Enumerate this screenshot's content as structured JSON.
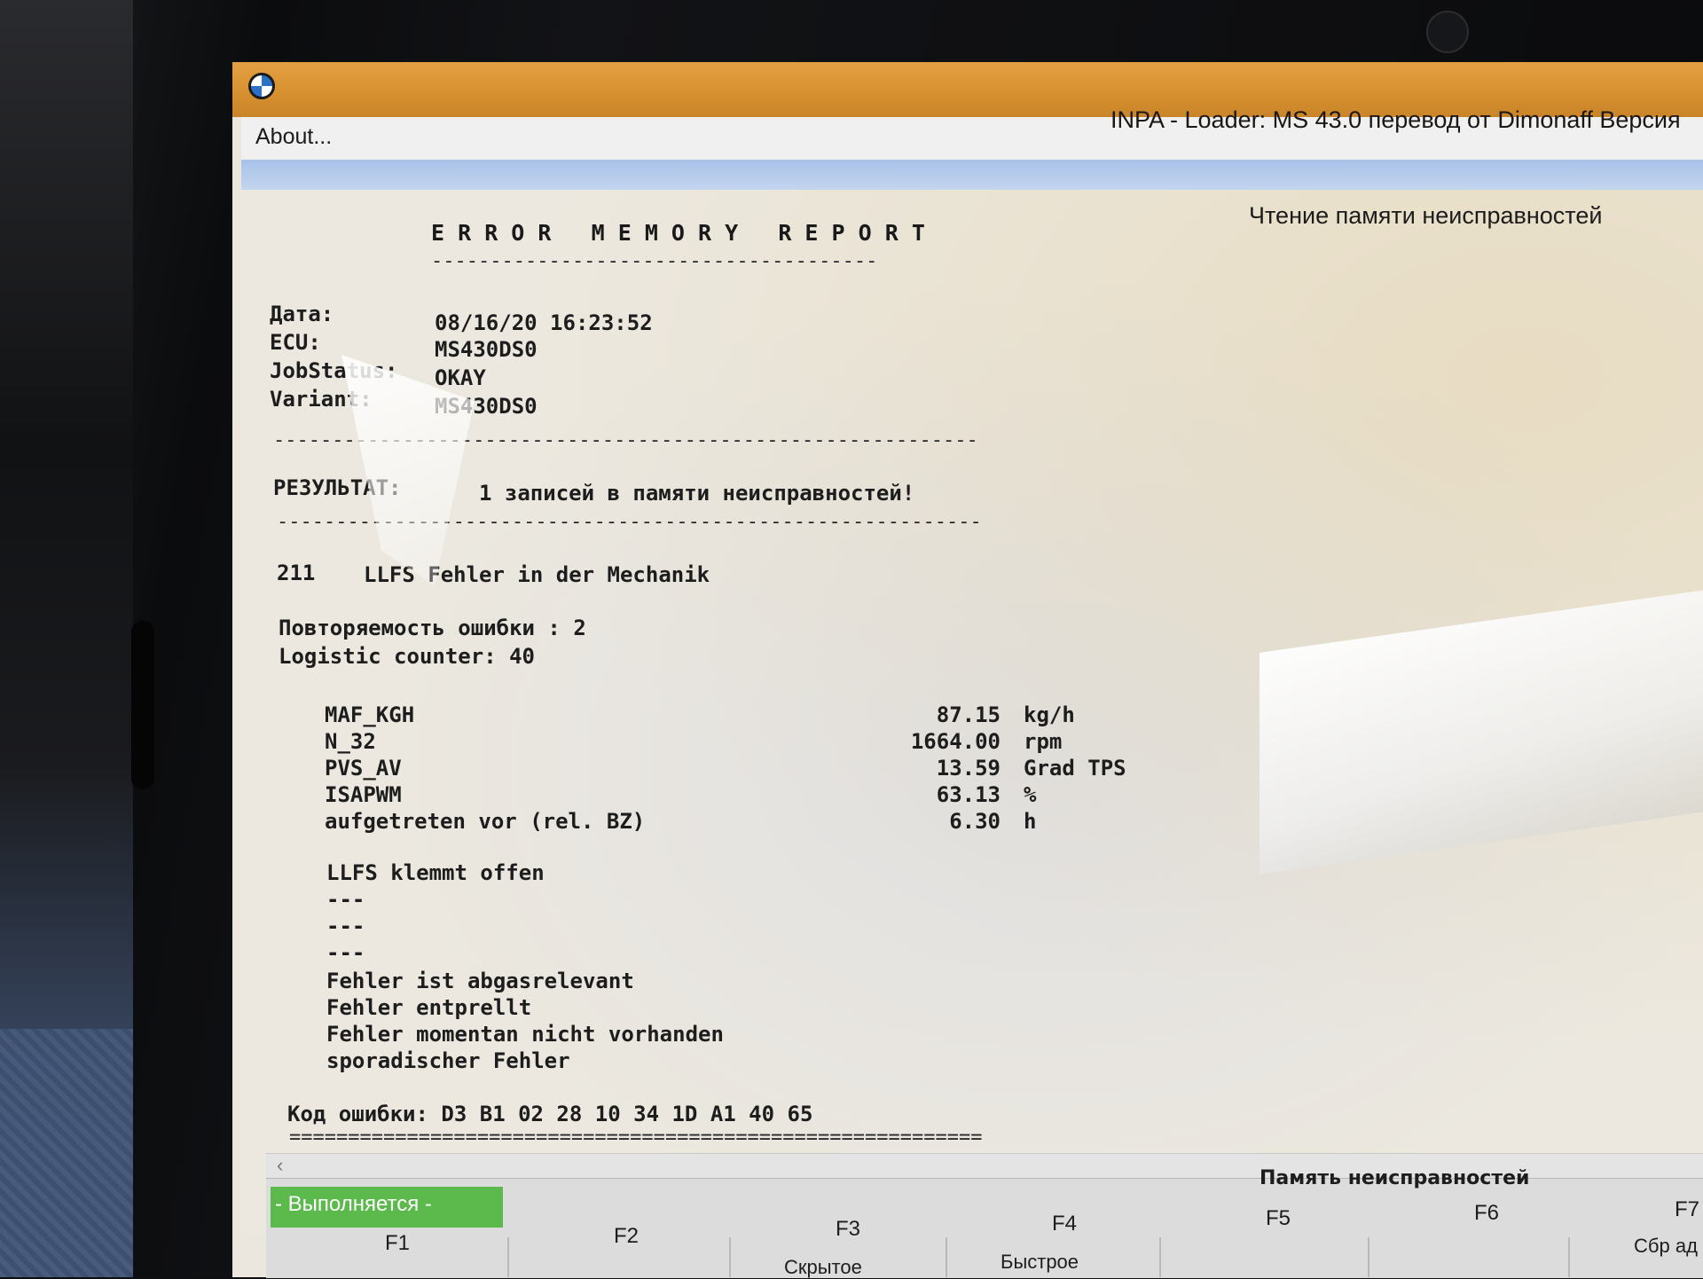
{
  "window": {
    "title": "INPA - Loader:  MS 43.0 перевод от Dimonaff Версия",
    "menu_about": "About...",
    "header_right": "Чтение памяти неисправностей"
  },
  "report": {
    "title": "E R R O R   M E M O R Y   R E P O R T",
    "title_underline": "--------------------------------------",
    "date_label": "Дата:",
    "date_value": "08/16/20 16:23:52",
    "ecu_label": "ECU:",
    "ecu_value": "MS430DS0",
    "jobstatus_label": "JobStatus:",
    "jobstatus_value": "OKAY",
    "variant_label": "Variant:",
    "variant_value": "MS430DS0",
    "separator": "------------------------------------------------------------",
    "result_label": "РЕЗУЛЬТАТ:",
    "result_value": "1 записей в памяти неисправностей!",
    "error_code": "211",
    "error_text": "LLFS Fehler in der Mechanik",
    "repeat_line": "Повторяемость ошибки : 2",
    "logistic_line": "Logistic counter: 40",
    "params": [
      {
        "name": "MAF_KGH",
        "value": "87.15",
        "unit": "kg/h"
      },
      {
        "name": "N_32",
        "value": "1664.00",
        "unit": "rpm"
      },
      {
        "name": "PVS_AV",
        "value": "13.59",
        "unit": "Grad TPS"
      },
      {
        "name": "ISAPWM",
        "value": "63.13",
        "unit": "%"
      },
      {
        "name": "aufgetreten vor (rel. BZ)",
        "value": "6.30",
        "unit": "h"
      }
    ],
    "status_lines": [
      "LLFS klemmt offen",
      "---",
      "---",
      "---",
      "Fehler ist abgasrelevant",
      "Fehler entprellt",
      "Fehler momentan nicht vorhanden",
      "sporadischer Fehler"
    ],
    "fault_code_line": "Код ошибки: D3 B1 02 28 10 34 1D A1 40 65",
    "end_separator": "==========================================================="
  },
  "footer": {
    "status": "- Выполняется -",
    "group_label": "Память неисправностей",
    "fkeys": [
      {
        "key": "F1",
        "sub": ""
      },
      {
        "key": "F2",
        "sub": ""
      },
      {
        "key": "F3",
        "sub": "Скрытое"
      },
      {
        "key": "F4",
        "sub": "Быстрое"
      },
      {
        "key": "F5",
        "sub": ""
      },
      {
        "key": "F6",
        "sub": ""
      },
      {
        "key": "F7",
        "sub": "Сбр ад"
      }
    ]
  }
}
